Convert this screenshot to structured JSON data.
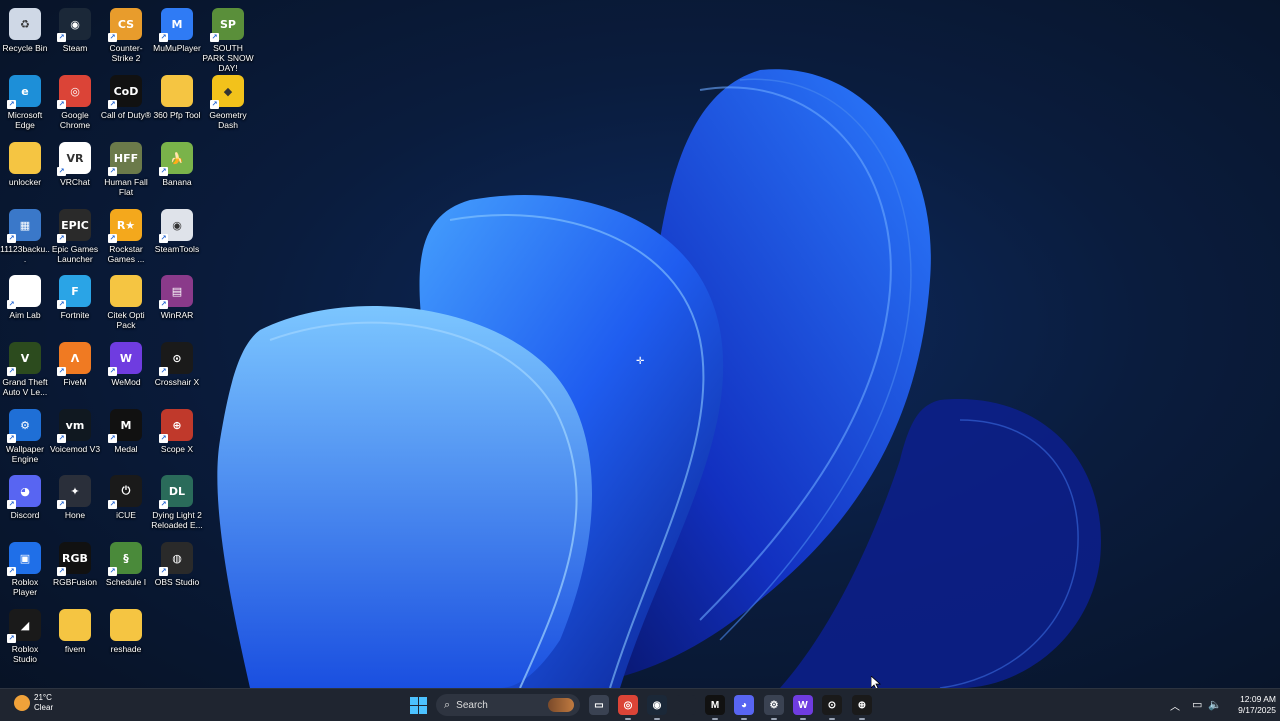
{
  "desktop": {
    "icons": [
      {
        "label": "Recycle Bin",
        "icon": "recycle-bin-icon",
        "color": "#cfd8e6",
        "glyph": "♻"
      },
      {
        "label": "Steam",
        "icon": "steam-icon",
        "color": "#1b2838",
        "glyph": "◉"
      },
      {
        "label": "Counter-Strike 2",
        "icon": "counter-strike-icon",
        "color": "#e89c2c",
        "glyph": "CS"
      },
      {
        "label": "MuMuPlayer",
        "icon": "mumuplayer-icon",
        "color": "#2f7bf5",
        "glyph": "M"
      },
      {
        "label": "SOUTH PARK SNOW DAY!",
        "icon": "south-park-icon",
        "color": "#5a8f3a",
        "glyph": "SP"
      },
      {
        "label": "Microsoft Edge",
        "icon": "edge-icon",
        "color": "#1d8fd8",
        "glyph": "e"
      },
      {
        "label": "Google Chrome",
        "icon": "chrome-icon",
        "color": "#db4437",
        "glyph": "◎"
      },
      {
        "label": "Call of Duty®",
        "icon": "call-of-duty-icon",
        "color": "#111111",
        "glyph": "CoD"
      },
      {
        "label": "360 Pfp Tool",
        "icon": "folder-icon",
        "color": "#f5c542",
        "glyph": ""
      },
      {
        "label": "Geometry Dash",
        "icon": "geometry-dash-icon",
        "color": "#f2c21b",
        "glyph": "◆"
      },
      {
        "label": "unlocker",
        "icon": "folder-icon",
        "color": "#f5c542",
        "glyph": ""
      },
      {
        "label": "VRChat",
        "icon": "vrchat-icon",
        "color": "#ffffff",
        "glyph": "VR"
      },
      {
        "label": "Human Fall Flat",
        "icon": "human-fall-flat-icon",
        "color": "#6b7a4a",
        "glyph": "HFF"
      },
      {
        "label": "Banana",
        "icon": "banana-icon",
        "color": "#7ab34a",
        "glyph": "🍌"
      },
      {
        "label": "11123backu...",
        "icon": "archive-icon",
        "color": "#3a78c9",
        "glyph": "▦"
      },
      {
        "label": "Epic Games Launcher",
        "icon": "epic-games-icon",
        "color": "#2a2a2a",
        "glyph": "EPIC"
      },
      {
        "label": "Rockstar Games ...",
        "icon": "rockstar-icon",
        "color": "#f4a81c",
        "glyph": "R★"
      },
      {
        "label": "SteamTools",
        "icon": "steamtools-icon",
        "color": "#dfe3ea",
        "glyph": "◉"
      },
      {
        "label": "Aim Lab",
        "icon": "file-icon",
        "color": "#ffffff",
        "glyph": ""
      },
      {
        "label": "Fortnite",
        "icon": "fortnite-icon",
        "color": "#2aa4e6",
        "glyph": "F"
      },
      {
        "label": "Citek Opti Pack",
        "icon": "folder-icon",
        "color": "#f5c542",
        "glyph": ""
      },
      {
        "label": "WinRAR",
        "icon": "winrar-icon",
        "color": "#8a3a8a",
        "glyph": "▤"
      },
      {
        "label": "Grand Theft Auto V Le...",
        "icon": "gta-v-icon",
        "color": "#2c4b1e",
        "glyph": "V"
      },
      {
        "label": "FiveM",
        "icon": "fivem-icon",
        "color": "#f07a22",
        "glyph": "Λ"
      },
      {
        "label": "WeMod",
        "icon": "wemod-icon",
        "color": "#6f3ce0",
        "glyph": "W"
      },
      {
        "label": "Crosshair X",
        "icon": "crosshair-x-icon",
        "color": "#1a1a1a",
        "glyph": "⊙"
      },
      {
        "label": "Wallpaper Engine",
        "icon": "wallpaper-engine-icon",
        "color": "#1f6fd6",
        "glyph": "⚙"
      },
      {
        "label": "Voicemod V3",
        "icon": "voicemod-icon",
        "color": "#101820",
        "glyph": "vm"
      },
      {
        "label": "Medal",
        "icon": "medal-icon",
        "color": "#111111",
        "glyph": "M"
      },
      {
        "label": "Scope X",
        "icon": "scope-x-icon",
        "color": "#c0392b",
        "glyph": "⊕"
      },
      {
        "label": "Discord",
        "icon": "discord-icon",
        "color": "#5865f2",
        "glyph": "◕"
      },
      {
        "label": "Hone",
        "icon": "hone-icon",
        "color": "#2a2f3a",
        "glyph": "✦"
      },
      {
        "label": "iCUE",
        "icon": "icue-icon",
        "color": "#1a1a1a",
        "glyph": "⏻"
      },
      {
        "label": "Dying Light 2 Reloaded E...",
        "icon": "dying-light-icon",
        "color": "#2a6b5a",
        "glyph": "DL"
      },
      {
        "label": "Roblox Player",
        "icon": "roblox-icon",
        "color": "#1f6fe8",
        "glyph": "▣"
      },
      {
        "label": "RGBFusion",
        "icon": "rgbfusion-icon",
        "color": "#111111",
        "glyph": "RGB"
      },
      {
        "label": "Schedule I",
        "icon": "schedule-i-icon",
        "color": "#4a8a3a",
        "glyph": "§"
      },
      {
        "label": "OBS Studio",
        "icon": "obs-icon",
        "color": "#2a2a2a",
        "glyph": "◍"
      },
      {
        "label": "Roblox Studio",
        "icon": "roblox-studio-icon",
        "color": "#1a1a1a",
        "glyph": "◢"
      },
      {
        "label": "fivem",
        "icon": "folder-icon",
        "color": "#f5c542",
        "glyph": ""
      },
      {
        "label": "reshade",
        "icon": "folder-icon",
        "color": "#f5c542",
        "glyph": ""
      }
    ]
  },
  "taskbar": {
    "weather": {
      "temp": "21°C",
      "condition": "Clear"
    },
    "search_label": "Search",
    "pinned": [
      {
        "name": "task-view",
        "color": "#3a4252",
        "glyph": "▭"
      },
      {
        "name": "chrome",
        "color": "#db4437",
        "glyph": "◎"
      },
      {
        "name": "steam",
        "color": "#1b2838",
        "glyph": "◉"
      },
      {
        "name": "blank",
        "color": "#1f2530",
        "glyph": ""
      },
      {
        "name": "medal",
        "color": "#111111",
        "glyph": "M"
      },
      {
        "name": "discord",
        "color": "#5865f2",
        "glyph": "◕"
      },
      {
        "name": "settings",
        "color": "#3a4252",
        "glyph": "⚙"
      },
      {
        "name": "wemod",
        "color": "#6f3ce0",
        "glyph": "W"
      },
      {
        "name": "crosshair-x",
        "color": "#1a1a1a",
        "glyph": "⊙"
      },
      {
        "name": "scope-x",
        "color": "#1a1a1a",
        "glyph": "⊕"
      }
    ],
    "clock": {
      "time": "12:09 AM",
      "date": "9/17/2025"
    }
  }
}
